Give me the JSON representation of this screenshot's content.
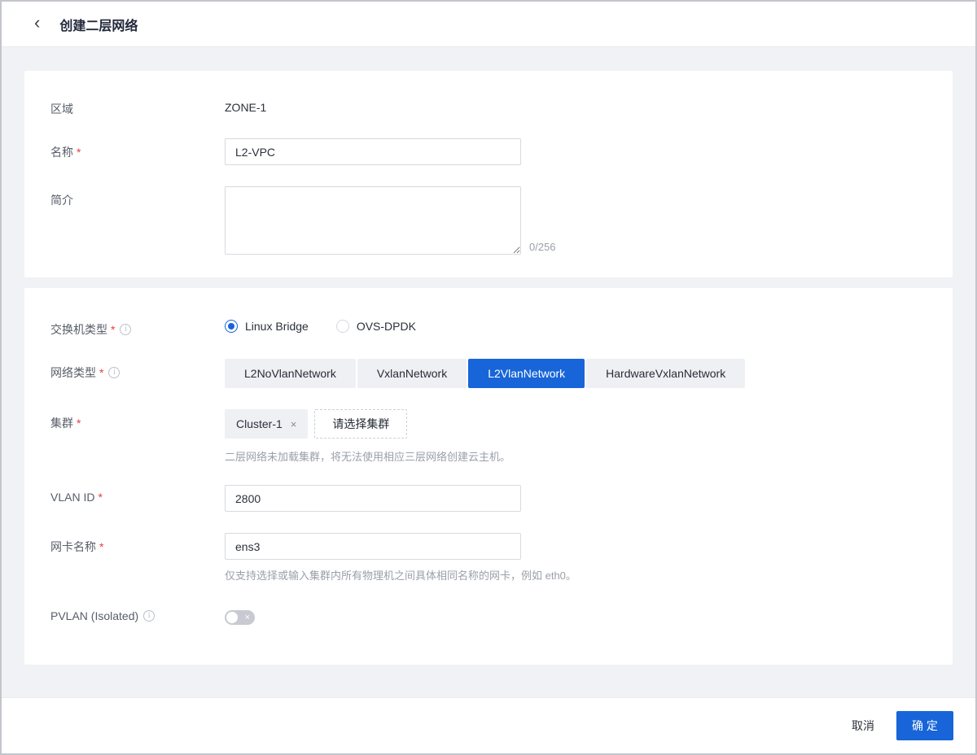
{
  "header": {
    "title": "创建二层网络",
    "back_icon": "‹"
  },
  "sections": {
    "basic": {
      "zone": {
        "label": "区域",
        "value": "ZONE-1"
      },
      "name": {
        "label": "名称",
        "value": "L2-VPC"
      },
      "description": {
        "label": "简介",
        "value": "",
        "counter": "0/256"
      }
    },
    "network": {
      "switch_type": {
        "label": "交换机类型",
        "options": [
          {
            "label": "Linux Bridge",
            "selected": true
          },
          {
            "label": "OVS-DPDK",
            "selected": false
          }
        ]
      },
      "network_type": {
        "label": "网络类型",
        "options": [
          "L2NoVlanNetwork",
          "VxlanNetwork",
          "L2VlanNetwork",
          "HardwareVxlanNetwork"
        ],
        "selected": "L2VlanNetwork"
      },
      "cluster": {
        "label": "集群",
        "selected_tag": "Cluster-1",
        "remove_icon": "×",
        "select_button_label": "请选择集群",
        "hint": "二层网络未加载集群，将无法使用相应三层网络创建云主机。"
      },
      "vlan_id": {
        "label": "VLAN ID",
        "value": "2800"
      },
      "nic_name": {
        "label": "网卡名称",
        "value": "ens3",
        "hint": "仅支持选择或输入集群内所有物理机之间具体相同名称的网卡，例如 eth0。"
      },
      "pvlan": {
        "label": "PVLAN (Isolated)",
        "state": "off",
        "off_icon": "×"
      }
    }
  },
  "footer": {
    "cancel_label": "取消",
    "confirm_label": "确 定"
  },
  "misc": {
    "required_marker": "*",
    "info_icon": "i"
  },
  "colors": {
    "primary_blue": "#1765d8",
    "required_red": "#f0383e",
    "page_background": "#f1f2f6"
  }
}
